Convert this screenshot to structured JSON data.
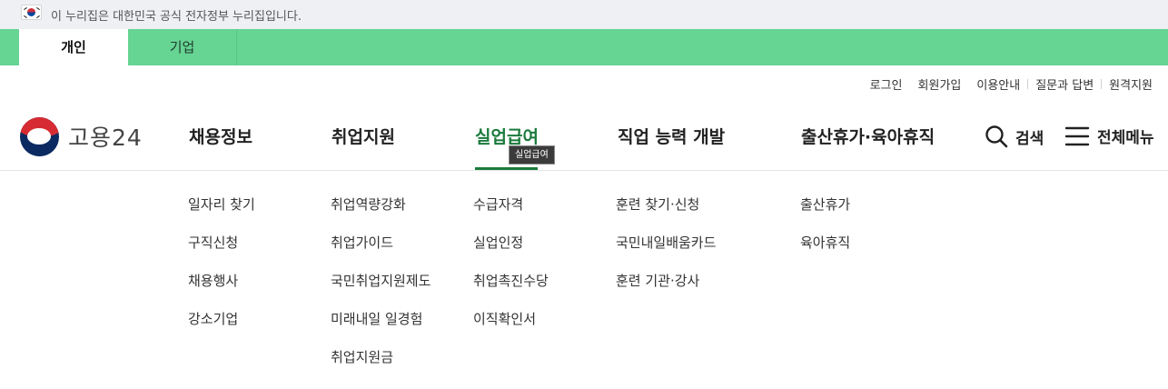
{
  "gov_banner": {
    "text": "이 누리집은 대한민국 공식 전자정부 누리집입니다."
  },
  "user_tabs": [
    {
      "label": "개인"
    },
    {
      "label": "기업"
    }
  ],
  "util_nav": [
    {
      "label": "로그인"
    },
    {
      "label": "회원가입"
    },
    {
      "label": "이용안내"
    },
    {
      "label": "질문과 답변"
    },
    {
      "label": "원격지원"
    }
  ],
  "logo": {
    "text": "고용24"
  },
  "gnb": [
    {
      "label": "채용정보",
      "sub": [
        "일자리 찾기",
        "구직신청",
        "채용행사",
        "강소기업"
      ]
    },
    {
      "label": "취업지원",
      "sub": [
        "취업역량강화",
        "취업가이드",
        "국민취업지원제도",
        "미래내일 일경험",
        "취업지원금"
      ]
    },
    {
      "label": "실업급여",
      "sub": [
        "수급자격",
        "실업인정",
        "취업촉진수당",
        "이직확인서"
      ]
    },
    {
      "label": "직업 능력 개발",
      "sub": [
        "훈련 찾기·신청",
        "국민내일배움카드",
        "훈련 기관·강사"
      ]
    },
    {
      "label": "출산휴가·육아휴직",
      "sub": [
        "출산휴가",
        "육아휴직"
      ]
    }
  ],
  "tooltip": {
    "text": "실업급여"
  },
  "actions": {
    "search_label": "검색",
    "menu_label": "전체메뉴"
  },
  "colors": {
    "accent": "#1a7a3c",
    "user_bar": "#66d493",
    "banner_bg": "#eef0f4"
  }
}
